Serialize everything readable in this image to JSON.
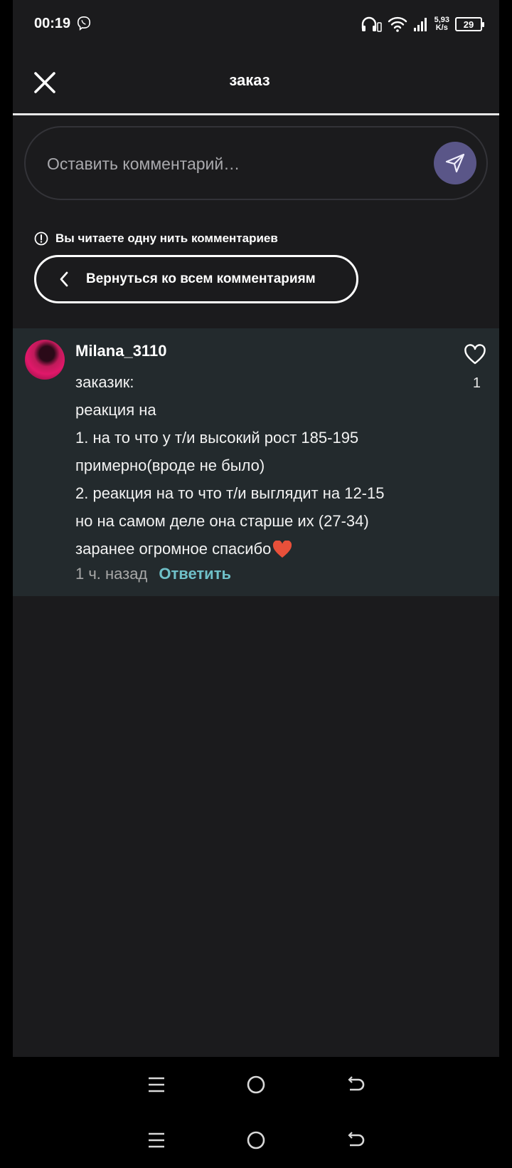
{
  "status_bar": {
    "time": "00:19",
    "speed_top": "5,93",
    "speed_bottom": "K/s",
    "battery": "29"
  },
  "header": {
    "title": "заказ"
  },
  "comment_input": {
    "placeholder": "Оставить комментарий…"
  },
  "thread": {
    "notice": "Вы читаете одну нить комментариев",
    "back_label": "Вернуться ко всем комментариям"
  },
  "comment": {
    "username": "Milana_3110",
    "lines": [
      "заказик:",
      "реакция на",
      "1. на то что у т/и высокий рост 185-195",
      "примерно(вроде не было)",
      "2. реакция на то что т/и выглядит на 12-15",
      "но на самом деле она старше их (27-34)",
      "заранее огромное спасибо"
    ],
    "timestamp": "1 ч. назад",
    "reply_label": "Ответить",
    "likes": "1"
  },
  "colors": {
    "background": "#1b1b1d",
    "comment_bg": "#232a2d",
    "accent": "#5a5688",
    "reply": "#6fc0c8"
  }
}
